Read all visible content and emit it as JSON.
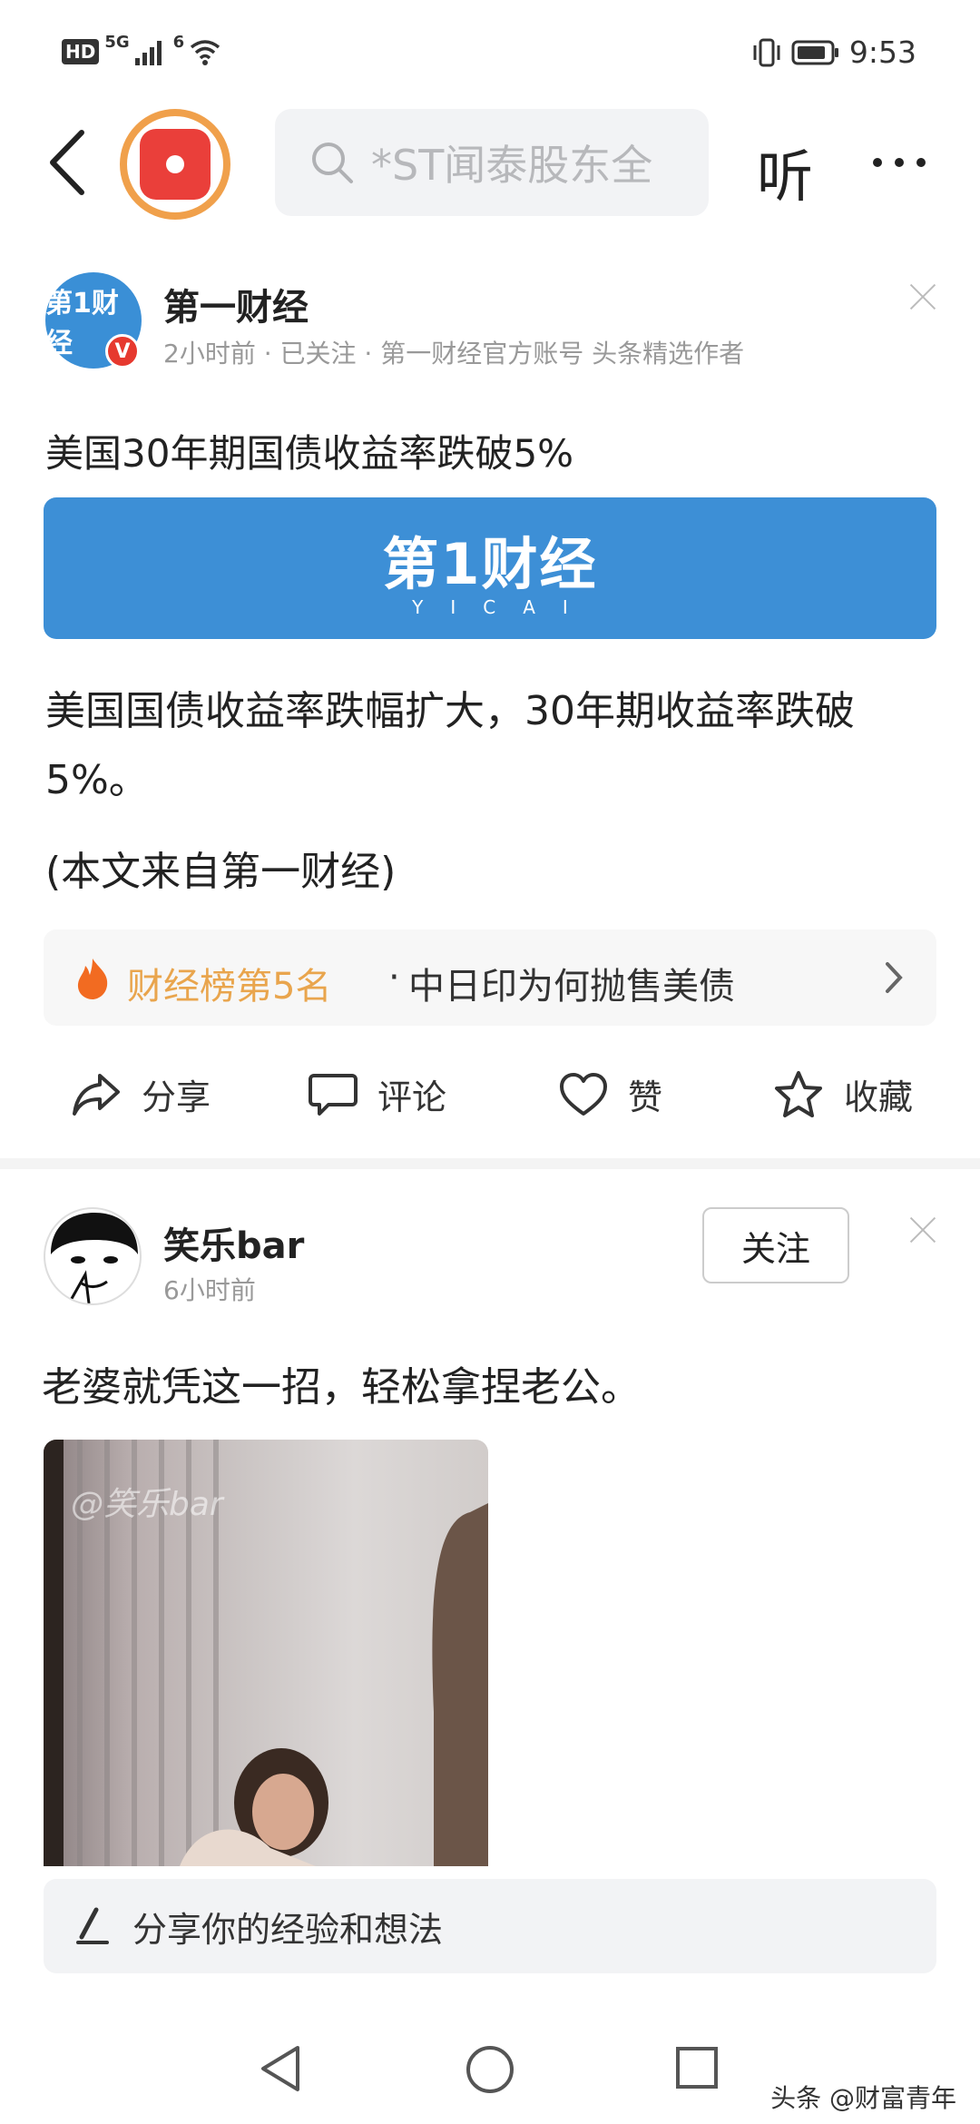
{
  "status_bar": {
    "hd": "HD",
    "network_1": "5G",
    "network_2": "6",
    "time": "9:53"
  },
  "top_nav": {
    "search_placeholder": "*ST闻泰股东全",
    "listen_label": "听"
  },
  "post1": {
    "author": "第一财经",
    "avatar_text": "第1财经",
    "meta": "2小时前 · 已关注 · 第一财经官方账号 头条精选作者",
    "title": "美国30年期国债收益率跌破5%",
    "banner_main": "第1财经",
    "banner_sub": "YICAI",
    "body": "美国国债收益率跌幅扩大，30年期收益率跌破5%。",
    "source": "(本文来自第一财经)",
    "hot_rank": "财经榜第5名",
    "hot_separator": "·",
    "hot_topic": "中日印为何抛售美债",
    "actions": {
      "share": "分享",
      "comment": "评论",
      "like": "赞",
      "favorite": "收藏"
    }
  },
  "post2": {
    "author": "笑乐bar",
    "meta": "6小时前",
    "follow_label": "关注",
    "text": "老婆就凭这一招，轻松拿捏老公。",
    "video_watermark": "@笑乐bar"
  },
  "comment_bar": {
    "placeholder": "分享你的经验和想法"
  },
  "watermark": "头条 @财富青年"
}
